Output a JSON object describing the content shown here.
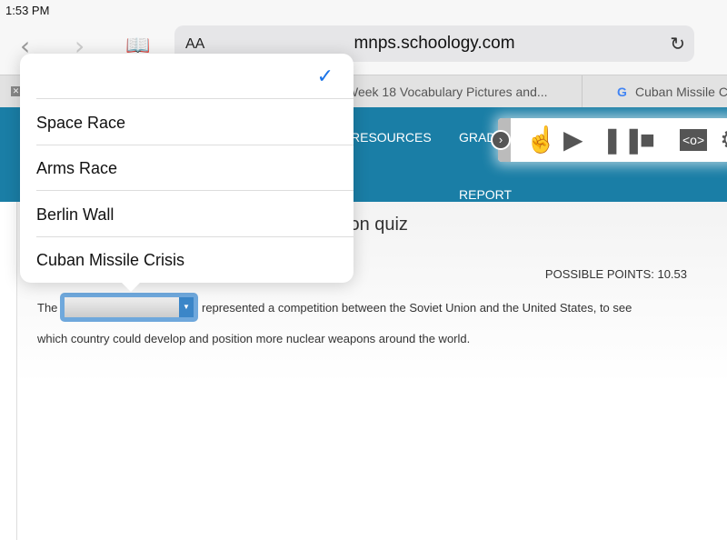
{
  "status_bar": {
    "time": "1:53 PM"
  },
  "browser": {
    "text_size_label": "AA",
    "url": "mnps.schoology.com",
    "tabs": [
      {
        "title": "Week 18 Vocabulary Pictures and..."
      },
      {
        "title": "Cuban Missile C"
      }
    ]
  },
  "site_nav": {
    "items": [
      "RESOURCES",
      "GRADES",
      "REPORT"
    ]
  },
  "page": {
    "title_fragment": "sion quiz",
    "possible_points": "POSSIBLE POINTS: 10.53",
    "question_before": "The",
    "question_after": "represented a competition between the Soviet Union and the United States, to see",
    "question_line2": "which country could develop and position more nuclear weapons around the world."
  },
  "dropdown": {
    "selected": "",
    "options": [
      "",
      "Space Race",
      "Arms Race",
      "Berlin Wall",
      "Cuban Missile Crisis"
    ]
  },
  "colors": {
    "nav": "#1a7ea6",
    "check": "#1a73e8"
  }
}
